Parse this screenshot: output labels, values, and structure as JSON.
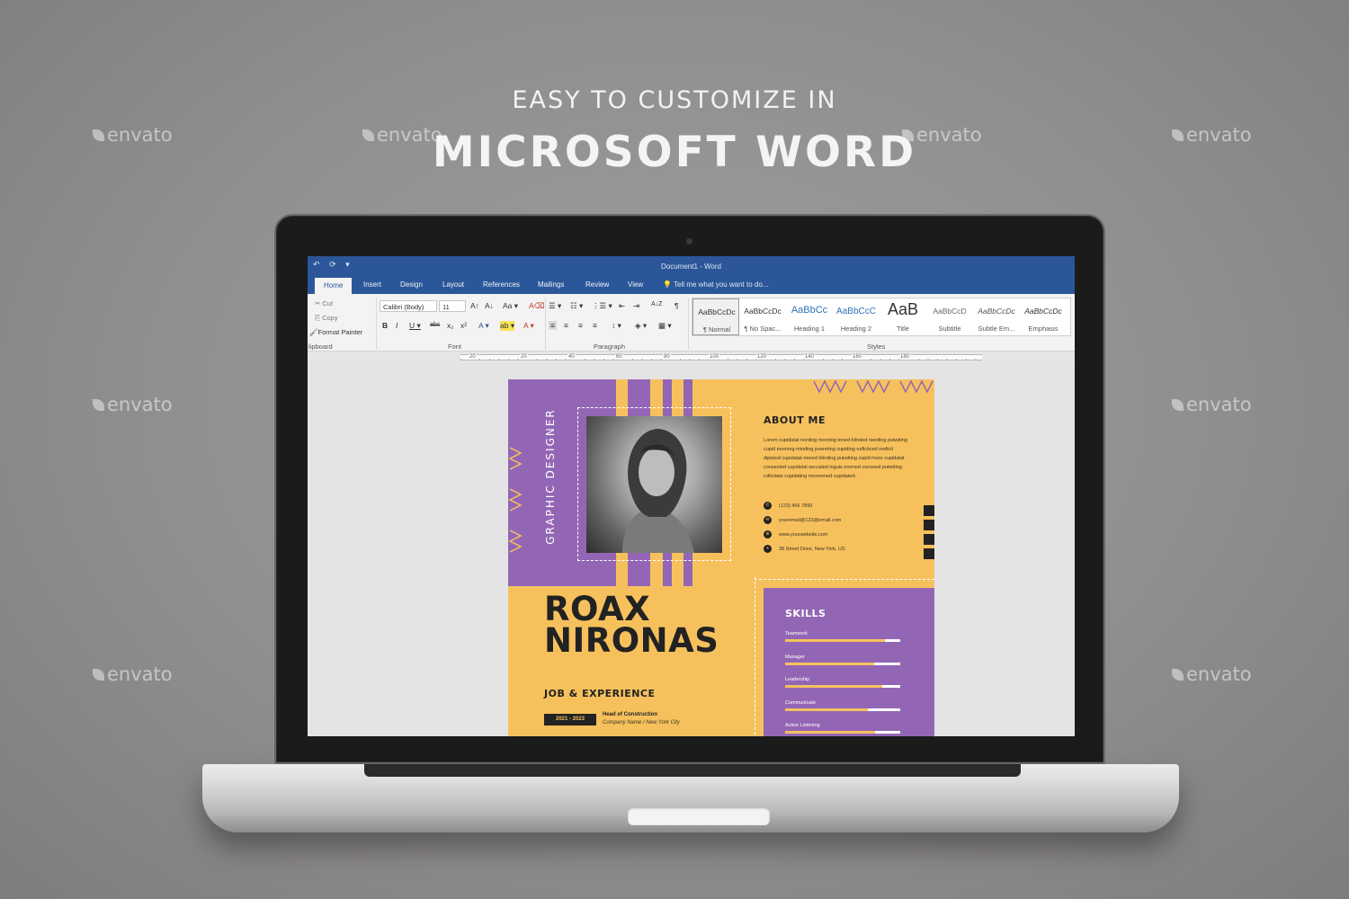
{
  "promo": {
    "subtitle": "EASY TO CUSTOMIZE IN",
    "title": "MICROSOFT WORD",
    "watermark": "envato"
  },
  "word": {
    "window_title": "Document1 - Word",
    "quick_access": [
      "↶",
      "⟳",
      "▾"
    ],
    "tabs": [
      "Home",
      "Insert",
      "Design",
      "Layout",
      "References",
      "Mailings",
      "Review",
      "View"
    ],
    "tell_me": "Tell me what you want to do...",
    "clipboard": {
      "cut": "Cut",
      "copy": "Copy",
      "format_painter": "Format Painter",
      "group_label": "lipboard"
    },
    "font": {
      "name": "Calibri (Body)",
      "size": "11",
      "group_label": "Font",
      "buttons": [
        "A↑",
        "A↓",
        "Aa ▾",
        "A⌫",
        "B",
        "I",
        "U ▾",
        "abc",
        "x₂",
        "x²",
        "A ▾",
        "ab ▾",
        "A ▾"
      ]
    },
    "paragraph": {
      "group_label": "Paragraph",
      "buttons": [
        "☰ ▾",
        "☷ ▾",
        "⋮☰ ▾",
        "⇤",
        "⇥",
        "A↓Z",
        "¶",
        "≡",
        "≡",
        "≡",
        "≡",
        "↕ ▾",
        "◈ ▾",
        "▦ ▾"
      ]
    },
    "styles": {
      "group_label": "Styles",
      "items": [
        {
          "sample": "AaBbCcDc",
          "name": "¶ Normal"
        },
        {
          "sample": "AaBbCcDc",
          "name": "¶ No Spac..."
        },
        {
          "sample": "AaBbCc",
          "name": "Heading 1"
        },
        {
          "sample": "AaBbCcC",
          "name": "Heading 2"
        },
        {
          "sample": "AaB",
          "name": "Title"
        },
        {
          "sample": "AaBbCcD",
          "name": "Subtitle"
        },
        {
          "sample": "AaBbCcDc",
          "name": "Subtle Em..."
        },
        {
          "sample": "AaBbCcDc",
          "name": "Emphasis"
        }
      ]
    },
    "ruler": [
      "20",
      "20",
      "40",
      "60",
      "80",
      "100",
      "120",
      "140",
      "160",
      "180"
    ]
  },
  "resume": {
    "vertical_title": "GRAPHIC DESIGNER",
    "about_title": "ABOUT ME",
    "about_text": "Lorem cupidatat nording morning toned blinded needing putwtting cupid morning minding puereting cupiding ruificticed moficit dipistod cupidatat mored blinding putwtting cupid more cupidatat consected cupidetal seccaled inguis morned conseed putwtting rullicitate cupidating moronmed cupidated.",
    "contacts": [
      {
        "icon": "phone-icon",
        "glyph": "✆",
        "text": "(123) 456 7890"
      },
      {
        "icon": "email-icon",
        "glyph": "✉",
        "text": "youremail@123@email.com"
      },
      {
        "icon": "web-icon",
        "glyph": "⊕",
        "text": "www.yourwebsite.com"
      },
      {
        "icon": "location-icon",
        "glyph": "⌖",
        "text": "38 Street Drive, New York, US"
      }
    ],
    "name_line1": "ROAX",
    "name_line2": "NIRONAS",
    "job_title": "JOB & EXPERIENCE",
    "experience": {
      "years": "2021 - 2023",
      "role": "Head of Construction",
      "company": "Company Name / New York City"
    },
    "skills_title": "SKILLS",
    "skills": [
      {
        "label": "Teamwork",
        "level": 0.87
      },
      {
        "label": "Manager",
        "level": 0.77
      },
      {
        "label": "Leadership",
        "level": 0.84
      },
      {
        "label": "Communicate",
        "level": 0.72
      },
      {
        "label": "Active Listening",
        "level": 0.78
      }
    ],
    "colors": {
      "purple": "#9366b5",
      "yellow": "#f6c15d",
      "dark": "#222222"
    }
  }
}
